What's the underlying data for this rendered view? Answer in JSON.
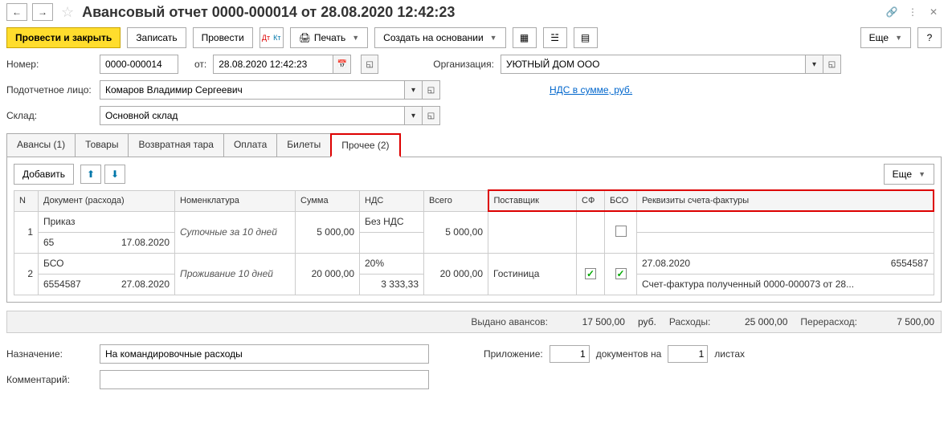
{
  "header": {
    "title": "Авансовый отчет 0000-000014 от 28.08.2020 12:42:23"
  },
  "toolbar": {
    "post_close": "Провести и закрыть",
    "save": "Записать",
    "post": "Провести",
    "print": "Печать",
    "create_based": "Создать на основании",
    "more": "Еще"
  },
  "fields": {
    "number_label": "Номер:",
    "number": "0000-000014",
    "from_label": "от:",
    "date": "28.08.2020 12:42:23",
    "org_label": "Организация:",
    "org": "УЮТНЫЙ ДОМ ООО",
    "person_label": "Подотчетное лицо:",
    "person": "Комаров Владимир Сергеевич",
    "vat_link": "НДС в сумме, руб.",
    "warehouse_label": "Склад:",
    "warehouse": "Основной склад"
  },
  "tabs": {
    "advances": "Авансы (1)",
    "goods": "Товары",
    "returnable": "Возвратная тара",
    "payment": "Оплата",
    "tickets": "Билеты",
    "other": "Прочее (2)"
  },
  "tabToolbar": {
    "add": "Добавить",
    "more": "Еще"
  },
  "table": {
    "headers": {
      "n": "N",
      "doc": "Документ (расхода)",
      "nomen": "Номенклатура",
      "sum": "Сумма",
      "vat": "НДС",
      "total": "Всего",
      "supplier": "Поставщик",
      "sf": "СФ",
      "bso": "БСО",
      "invoice": "Реквизиты счета-фактуры"
    },
    "rows": [
      {
        "n": "1",
        "doc1": "Приказ",
        "doc2": "65",
        "docdate": "17.08.2020",
        "nomen": "Суточные за 10 дней",
        "sum": "5 000,00",
        "vat1": "Без НДС",
        "vat2": "",
        "total": "5 000,00",
        "supplier": "",
        "sf": false,
        "bso": null,
        "inv1": "",
        "inv2": ""
      },
      {
        "n": "2",
        "doc1": "БСО",
        "doc2": "6554587",
        "docdate": "27.08.2020",
        "nomen": "Проживание 10 дней",
        "sum": "20 000,00",
        "vat1": "20%",
        "vat2": "3 333,33",
        "total": "20 000,00",
        "supplier": "Гостиница",
        "sf": true,
        "bso": true,
        "inv1a": "27.08.2020",
        "inv1b": "6554587",
        "inv2": "Счет-фактура полученный 0000-000073 от 28..."
      }
    ]
  },
  "totals": {
    "advances_label": "Выдано авансов:",
    "advances": "17 500,00",
    "currency": "руб.",
    "expenses_label": "Расходы:",
    "expenses": "25 000,00",
    "over_label": "Перерасход:",
    "over": "7 500,00"
  },
  "footer": {
    "purpose_label": "Назначение:",
    "purpose": "На командировочные расходы",
    "attach_label": "Приложение:",
    "attach1": "1",
    "attach_mid": "документов на",
    "attach2": "1",
    "attach_end": "листах",
    "comment_label": "Комментарий:"
  }
}
